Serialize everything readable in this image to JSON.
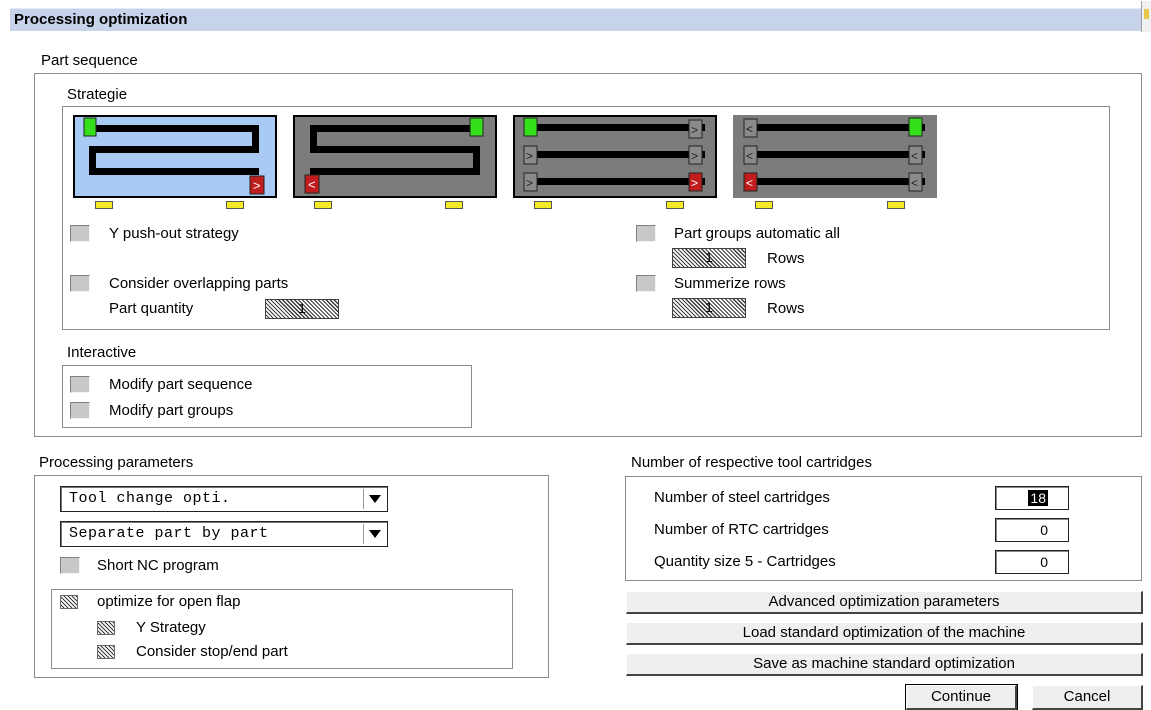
{
  "window": {
    "title": "Processing optimization"
  },
  "part_sequence": {
    "title": "Part sequence",
    "strategie": {
      "title": "Strategie",
      "tiles": [
        {
          "name": "strategy-snake-horizontal",
          "selected": true
        },
        {
          "name": "strategy-snake-reverse",
          "selected": false
        },
        {
          "name": "strategy-rows-left-to-right",
          "selected": false
        },
        {
          "name": "strategy-rows-right-to-left",
          "selected": false
        }
      ],
      "y_pushout_label": "Y push-out strategy",
      "consider_overlapping_label": "Consider overlapping parts",
      "part_quantity_label": "Part quantity",
      "part_quantity_value": "1",
      "part_groups_auto_label": "Part groups automatic all",
      "part_groups_rows_value": "1",
      "part_groups_rows_label": "Rows",
      "summerize_rows_label": "Summerize rows",
      "summerize_rows_value": "1",
      "summerize_rows_label2": "Rows"
    },
    "interactive": {
      "title": "Interactive",
      "modify_sequence_label": "Modify part sequence",
      "modify_groups_label": "Modify part groups"
    }
  },
  "processing_parameters": {
    "title": "Processing parameters",
    "dropdown1": "Tool change opti.",
    "dropdown2": "Separate part by part",
    "short_nc_label": "Short NC program",
    "optimize_open_flap_label": "optimize for open flap",
    "y_strategy_label": "Y Strategy",
    "consider_stop_label": "Consider stop/end part"
  },
  "cartridges": {
    "title": "Number of respective tool cartridges",
    "steel_label": "Number of steel cartridges",
    "steel_value": "18",
    "rtc_label": "Number of RTC cartridges",
    "rtc_value": "0",
    "size5_label": "Quantity size 5 - Cartridges",
    "size5_value": "0"
  },
  "buttons": {
    "advanced": "Advanced optimization parameters",
    "load_standard": "Load standard optimization of the machine",
    "save_standard": "Save as machine standard optimization",
    "continue": "Continue",
    "cancel": "Cancel"
  },
  "colors": {
    "titlebar": "#c7d3ea",
    "selected_tile": "#a9cbf3",
    "tile_gray": "#7c7c7c",
    "start_green": "#33e01a",
    "end_red": "#c01e1e",
    "foot_yellow": "#f4ea25"
  }
}
